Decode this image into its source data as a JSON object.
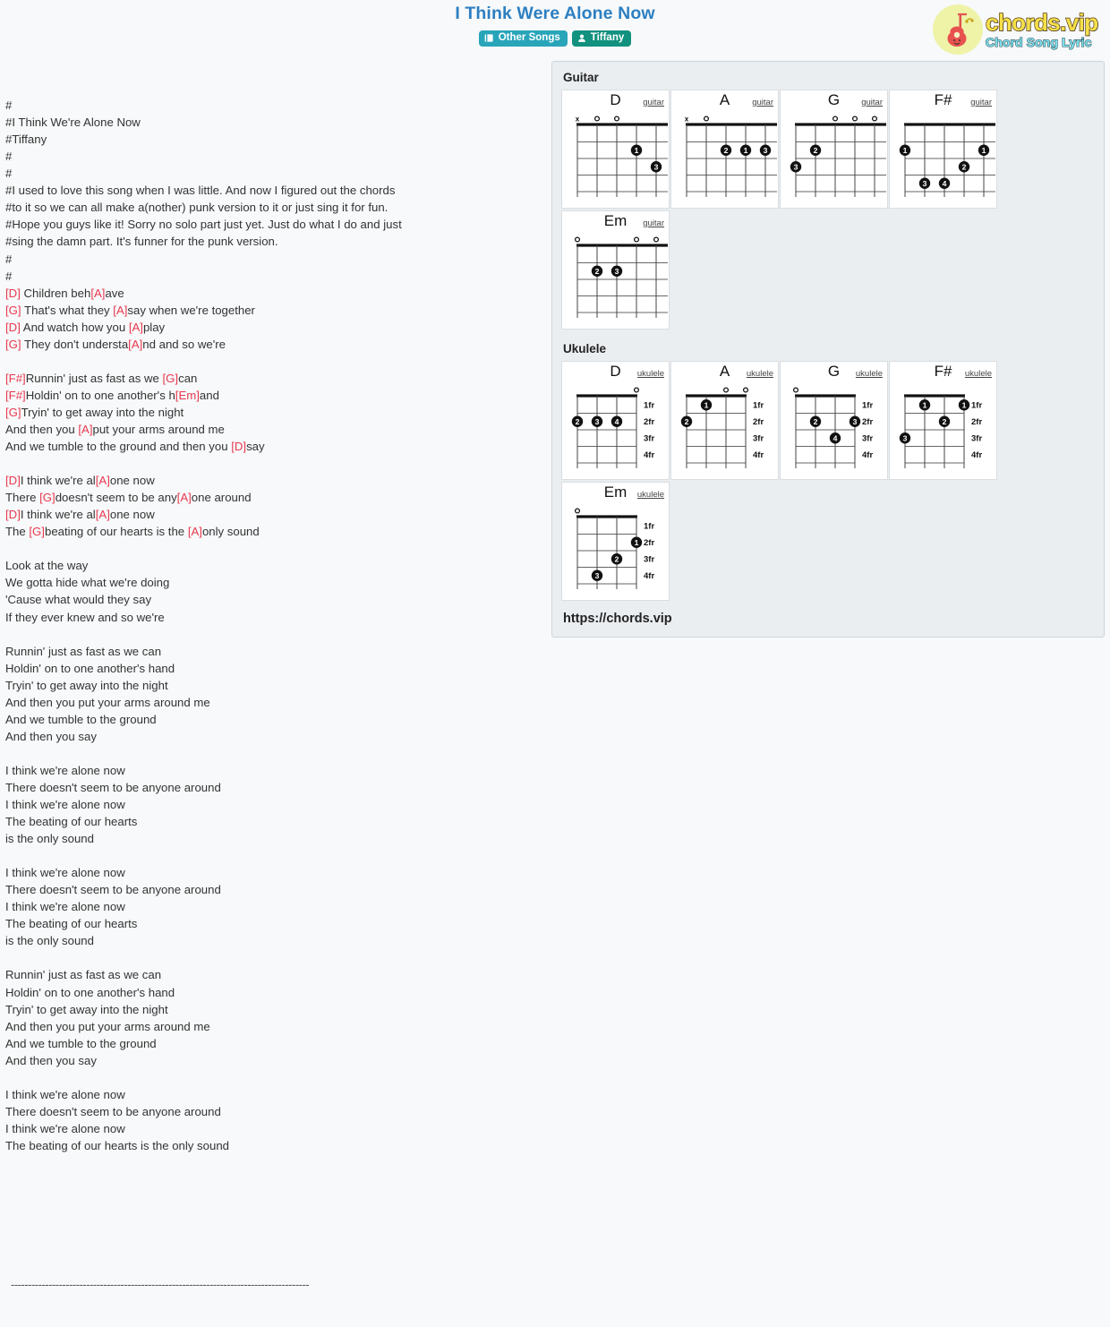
{
  "header": {
    "title": "I Think Were Alone Now",
    "badges": [
      {
        "label": "Other Songs",
        "icon": "book-icon",
        "color": "#29a5ba"
      },
      {
        "label": "Tiffany",
        "icon": "user-icon",
        "color": "#12917e"
      }
    ]
  },
  "logo": {
    "main": "chords.vip",
    "sub": "Chord Song Lyric",
    "icon": "guitar-icon"
  },
  "lyrics": {
    "blocks": [
      {
        "type": "plain",
        "lines": [
          "#",
          "#I Think We're Alone Now",
          "#Tiffany",
          "#",
          "#",
          "#I used to love this song when I was little. And now I figured out the chords",
          "#to it so we can all make a(nother) punk version to it or just sing it for fun.",
          "#Hope you guys like it! Sorry no solo part just yet. Just do what I do and just",
          "#sing the damn part. It's funner for the punk version.",
          "#",
          "#"
        ]
      },
      {
        "type": "chorded",
        "lines": [
          [
            {
              "c": "[D]"
            },
            {
              "t": " Children beh"
            },
            {
              "c": "[A]"
            },
            {
              "t": "ave"
            }
          ],
          [
            {
              "c": "[G]"
            },
            {
              "t": " That's what they "
            },
            {
              "c": "[A]"
            },
            {
              "t": "say when we're together"
            }
          ],
          [
            {
              "c": "[D]"
            },
            {
              "t": " And watch how you "
            },
            {
              "c": "[A]"
            },
            {
              "t": "play"
            }
          ],
          [
            {
              "c": "[G]"
            },
            {
              "t": " They don't understa"
            },
            {
              "c": "[A]"
            },
            {
              "t": "nd and so we're"
            }
          ],
          [
            {
              "t": ""
            }
          ],
          [
            {
              "c": "[F#]"
            },
            {
              "t": "Runnin' just as fast as we "
            },
            {
              "c": "[G]"
            },
            {
              "t": "can"
            }
          ],
          [
            {
              "c": "[F#]"
            },
            {
              "t": "Holdin' on to one another's h"
            },
            {
              "c": "[Em]"
            },
            {
              "t": "and"
            }
          ],
          [
            {
              "c": "[G]"
            },
            {
              "t": "Tryin' to get away into the night"
            }
          ],
          [
            {
              "t": "And then you "
            },
            {
              "c": "[A]"
            },
            {
              "t": "put your arms around me"
            }
          ],
          [
            {
              "t": "And we tumble to the ground and then you "
            },
            {
              "c": "[D]"
            },
            {
              "t": "say"
            }
          ],
          [
            {
              "t": ""
            }
          ],
          [
            {
              "c": "[D]"
            },
            {
              "t": "I think we're al"
            },
            {
              "c": "[A]"
            },
            {
              "t": "one now"
            }
          ],
          [
            {
              "t": "There "
            },
            {
              "c": "[G]"
            },
            {
              "t": "doesn't seem to be any"
            },
            {
              "c": "[A]"
            },
            {
              "t": "one around"
            }
          ],
          [
            {
              "c": "[D]"
            },
            {
              "t": "I think we're al"
            },
            {
              "c": "[A]"
            },
            {
              "t": "one now"
            }
          ],
          [
            {
              "t": "The "
            },
            {
              "c": "[G]"
            },
            {
              "t": "beating of our hearts is the "
            },
            {
              "c": "[A]"
            },
            {
              "t": "only sound"
            }
          ]
        ]
      },
      {
        "type": "plain",
        "lines": [
          "",
          "Look at the way",
          "We gotta hide what we're doing",
          "'Cause what would they say",
          "If they ever knew and so we're",
          "",
          "Runnin' just as fast as we can",
          "Holdin' on to one another's hand",
          "Tryin' to get away into the night",
          "And then you put your arms around me",
          "And we tumble to the ground",
          "And then you say",
          "",
          "I think we're alone now",
          "There doesn't seem to be anyone around",
          "I think we're alone now",
          "The beating of our hearts",
          "is the only sound",
          "",
          "I think we're alone now",
          "There doesn't seem to be anyone around",
          "I think we're alone now",
          "The beating of our hearts",
          "is the only sound",
          "",
          "Runnin' just as fast as we can",
          "Holdin' on to one another's hand",
          "Tryin' to get away into the night",
          "And then you put your arms around me",
          "And we tumble to the ground",
          "And then you say",
          "",
          "I think we're alone now",
          "There doesn't seem to be anyone around",
          "I think we're alone now",
          "The beating of our hearts is the only sound"
        ]
      }
    ],
    "divider": "---------------------------------------------------------------------------------------"
  },
  "panel": {
    "sections": [
      {
        "label": "Guitar",
        "instrument": "guitar",
        "strings": 6,
        "frets": 4,
        "fret_labels": [
          "1fr",
          "2fr",
          "3fr",
          "4fr"
        ],
        "chords": [
          {
            "name": "D",
            "markers": [
              {
                "string": 1,
                "type": "x"
              },
              {
                "string": 2,
                "type": "o"
              },
              {
                "string": 3,
                "type": "o"
              }
            ],
            "dots": [
              {
                "string": 4,
                "fret": 2,
                "finger": "1"
              },
              {
                "string": 6,
                "fret": 2,
                "finger": "2"
              },
              {
                "string": 5,
                "fret": 3,
                "finger": "3"
              }
            ]
          },
          {
            "name": "A",
            "markers": [
              {
                "string": 1,
                "type": "x"
              },
              {
                "string": 2,
                "type": "o"
              },
              {
                "string": 6,
                "type": "o"
              }
            ],
            "dots": [
              {
                "string": 3,
                "fret": 2,
                "finger": "2"
              },
              {
                "string": 4,
                "fret": 2,
                "finger": "1"
              },
              {
                "string": 5,
                "fret": 2,
                "finger": "3"
              }
            ]
          },
          {
            "name": "G",
            "markers": [
              {
                "string": 3,
                "type": "o"
              },
              {
                "string": 4,
                "type": "o"
              },
              {
                "string": 5,
                "type": "o"
              }
            ],
            "dots": [
              {
                "string": 2,
                "fret": 2,
                "finger": "2"
              },
              {
                "string": 1,
                "fret": 3,
                "finger": "3",
                "outside": true
              },
              {
                "string": 6,
                "fret": 3,
                "finger": "4",
                "outside": true
              }
            ]
          },
          {
            "name": "F#",
            "markers": [],
            "dots": [
              {
                "string": 1,
                "fret": 2,
                "finger": "1",
                "outside": true
              },
              {
                "string": 5,
                "fret": 2,
                "finger": "1"
              },
              {
                "string": 6,
                "fret": 2,
                "finger": "1",
                "outside": true
              },
              {
                "string": 4,
                "fret": 3,
                "finger": "2"
              },
              {
                "string": 2,
                "fret": 4,
                "finger": "3"
              },
              {
                "string": 3,
                "fret": 4,
                "finger": "4"
              }
            ]
          },
          {
            "name": "Em",
            "markers": [
              {
                "string": 1,
                "type": "o"
              },
              {
                "string": 4,
                "type": "o"
              },
              {
                "string": 5,
                "type": "o"
              },
              {
                "string": 6,
                "type": "o"
              }
            ],
            "dots": [
              {
                "string": 2,
                "fret": 2,
                "finger": "2"
              },
              {
                "string": 3,
                "fret": 2,
                "finger": "3"
              }
            ]
          }
        ]
      },
      {
        "label": "Ukulele",
        "instrument": "ukulele",
        "strings": 4,
        "frets": 4,
        "fret_labels": [
          "1fr",
          "2fr",
          "3fr",
          "4fr"
        ],
        "chords": [
          {
            "name": "D",
            "markers": [
              {
                "string": 4,
                "type": "o"
              }
            ],
            "dots": [
              {
                "string": 1,
                "fret": 2,
                "finger": "2",
                "outside": true
              },
              {
                "string": 2,
                "fret": 2,
                "finger": "3"
              },
              {
                "string": 3,
                "fret": 2,
                "finger": "4"
              }
            ]
          },
          {
            "name": "A",
            "markers": [
              {
                "string": 3,
                "type": "o"
              },
              {
                "string": 4,
                "type": "o"
              }
            ],
            "dots": [
              {
                "string": 2,
                "fret": 1,
                "finger": "1"
              },
              {
                "string": 1,
                "fret": 2,
                "finger": "2",
                "outside": true
              }
            ]
          },
          {
            "name": "G",
            "markers": [
              {
                "string": 1,
                "type": "o"
              }
            ],
            "dots": [
              {
                "string": 2,
                "fret": 2,
                "finger": "2"
              },
              {
                "string": 4,
                "fret": 2,
                "finger": "3"
              },
              {
                "string": 3,
                "fret": 3,
                "finger": "4"
              }
            ]
          },
          {
            "name": "F#",
            "markers": [],
            "dots": [
              {
                "string": 2,
                "fret": 1,
                "finger": "1"
              },
              {
                "string": 4,
                "fret": 1,
                "finger": "1"
              },
              {
                "string": 3,
                "fret": 2,
                "finger": "2"
              },
              {
                "string": 1,
                "fret": 3,
                "finger": "3",
                "outside": true
              }
            ]
          },
          {
            "name": "Em",
            "markers": [
              {
                "string": 1,
                "type": "o"
              }
            ],
            "dots": [
              {
                "string": 4,
                "fret": 2,
                "finger": "1"
              },
              {
                "string": 3,
                "fret": 3,
                "finger": "2"
              },
              {
                "string": 2,
                "fret": 4,
                "finger": "3"
              }
            ]
          }
        ]
      }
    ],
    "url": "https://chords.vip"
  }
}
